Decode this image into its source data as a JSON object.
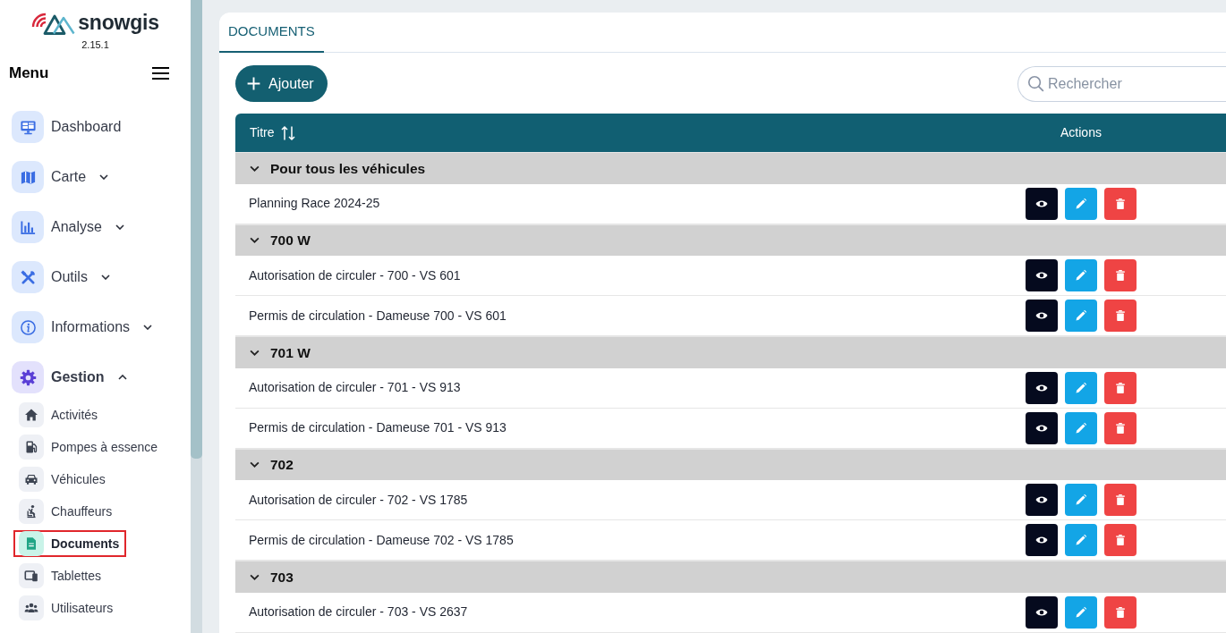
{
  "brand": {
    "name": "snowgis",
    "version": "2.15.1"
  },
  "sidebar": {
    "title": "Menu",
    "items": [
      {
        "label": "Dashboard",
        "kind": "link"
      },
      {
        "label": "Carte",
        "kind": "group",
        "expanded": false
      },
      {
        "label": "Analyse",
        "kind": "group",
        "expanded": false
      },
      {
        "label": "Outils",
        "kind": "group",
        "expanded": false
      },
      {
        "label": "Informations",
        "kind": "group",
        "expanded": false
      },
      {
        "label": "Gestion",
        "kind": "group",
        "expanded": true,
        "children": [
          {
            "label": "Activités",
            "selected": false
          },
          {
            "label": "Pompes à essence",
            "selected": false
          },
          {
            "label": "Véhicules",
            "selected": false
          },
          {
            "label": "Chauffeurs",
            "selected": false
          },
          {
            "label": "Documents",
            "selected": true
          },
          {
            "label": "Tablettes",
            "selected": false
          },
          {
            "label": "Utilisateurs",
            "selected": false
          }
        ]
      }
    ]
  },
  "tabs": [
    {
      "label": "DOCUMENTS",
      "selected": true
    }
  ],
  "add_button": {
    "label": "Ajouter"
  },
  "search": {
    "placeholder": "Rechercher"
  },
  "table": {
    "columns": [
      "Titre",
      "Actions"
    ],
    "groups": [
      {
        "label": "Pour tous les véhicules",
        "expanded": true,
        "rows": [
          "Planning Race 2024-25"
        ]
      },
      {
        "label": "700 W",
        "expanded": true,
        "rows": [
          "Autorisation de circuler - 700 - VS 601",
          "Permis de circulation - Dameuse 700 - VS 601"
        ]
      },
      {
        "label": "701 W",
        "expanded": true,
        "rows": [
          "Autorisation de circuler - 701 - VS 913",
          "Permis de circulation - Dameuse 701 - VS 913"
        ]
      },
      {
        "label": "702",
        "expanded": true,
        "rows": [
          "Autorisation de circuler - 702 - VS 1785",
          "Permis de circulation - Dameuse 702 - VS 1785"
        ]
      },
      {
        "label": "703",
        "expanded": true,
        "rows": [
          "Autorisation de circuler - 703 - VS 2637"
        ]
      }
    ]
  }
}
